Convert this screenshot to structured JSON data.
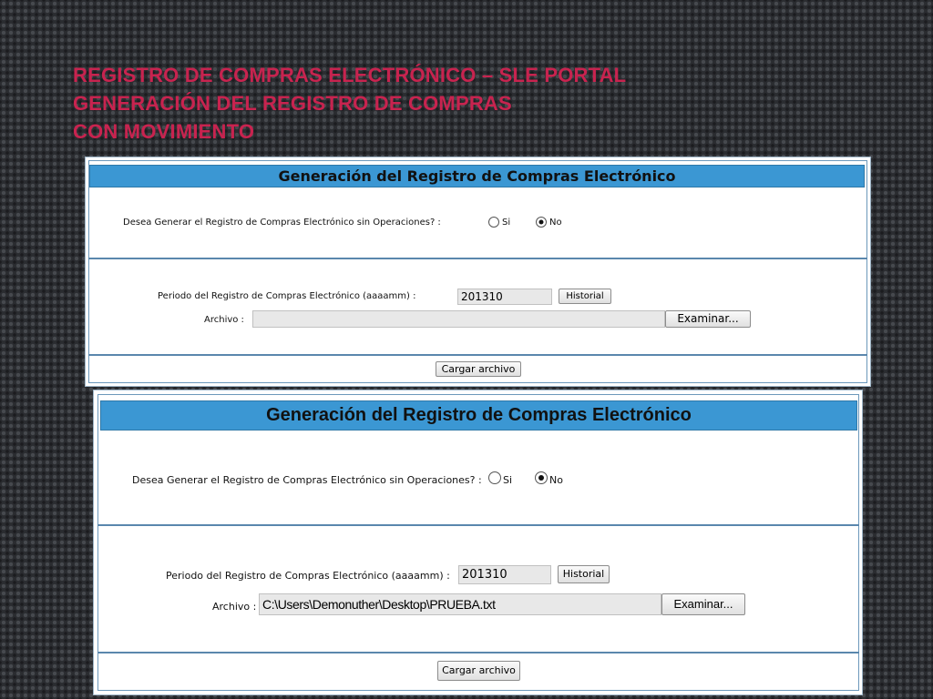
{
  "slide": {
    "title_lines": [
      "REGISTRO DE COMPRAS ELECTRÓNICO – SLE PORTAL",
      "GENERACIÓN DEL REGISTRO DE COMPRAS",
      "CON MOVIMIENTO"
    ],
    "title_color": "#c8234f"
  },
  "panels": [
    {
      "header": "Generación del Registro de Compras Electrónico",
      "question": "Desea Generar el Registro de Compras Electrónico sin Operaciones? :",
      "option_si": "Si",
      "option_no": "No",
      "selected_option": "No",
      "periodo_label": "Periodo del Registro de Compras Electrónico (aaaamm) :",
      "periodo_value": "201310",
      "historial_button": "Historial",
      "archivo_label": "Archivo :",
      "archivo_value": "",
      "examinar_button": "Examinar...",
      "cargar_button": "Cargar archivo"
    },
    {
      "header": "Generación del Registro de Compras Electrónico",
      "question": "Desea Generar el Registro de Compras Electrónico sin Operaciones? :",
      "option_si": "Si",
      "option_no": "No",
      "selected_option": "No",
      "periodo_label": "Periodo del Registro de Compras Electrónico (aaaamm) :",
      "periodo_value": "201310",
      "historial_button": "Historial",
      "archivo_label": "Archivo :",
      "archivo_value": "C:\\Users\\Demonuther\\Desktop\\PRUEBA.txt",
      "examinar_button": "Examinar...",
      "cargar_button": "Cargar archivo"
    }
  ],
  "colors": {
    "header_bg": "#3b97d3",
    "divider": "#5a87ad"
  }
}
